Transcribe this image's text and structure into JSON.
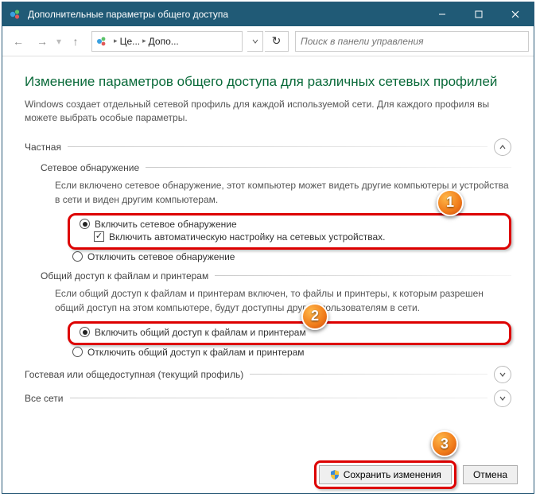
{
  "window": {
    "title": "Дополнительные параметры общего доступа"
  },
  "nav": {
    "crumb1": "Це...",
    "crumb2": "Допо...",
    "search_placeholder": "Поиск в панели управления"
  },
  "page": {
    "title": "Изменение параметров общего доступа для различных сетевых профилей",
    "desc": "Windows создает отдельный сетевой профиль для каждой используемой сети. Для каждого профиля вы можете выбрать особые параметры."
  },
  "sections": {
    "private": {
      "label": "Частная",
      "network_discovery": {
        "label": "Сетевое обнаружение",
        "desc": "Если включено сетевое обнаружение, этот компьютер может видеть другие компьютеры и устройства в сети и виден другим компьютерам.",
        "opt_on": "Включить сетевое обнаружение",
        "opt_auto": "Включить автоматическую настройку на сетевых устройствах.",
        "opt_off": "Отключить сетевое обнаружение"
      },
      "file_printer": {
        "label": "Общий доступ к файлам и принтерам",
        "desc": "Если общий доступ к файлам и принтерам включен, то файлы и принтеры, к которым разрешен общий доступ на этом компьютере, будут доступны другим пользователям в сети.",
        "opt_on": "Включить общий доступ к файлам и принтерам",
        "opt_off": "Отключить общий доступ к файлам и принтерам"
      }
    },
    "guest": {
      "label": "Гостевая или общедоступная (текущий профиль)"
    },
    "all": {
      "label": "Все сети"
    }
  },
  "buttons": {
    "save": "Сохранить изменения",
    "cancel": "Отмена"
  },
  "badges": {
    "b1": "1",
    "b2": "2",
    "b3": "3"
  }
}
